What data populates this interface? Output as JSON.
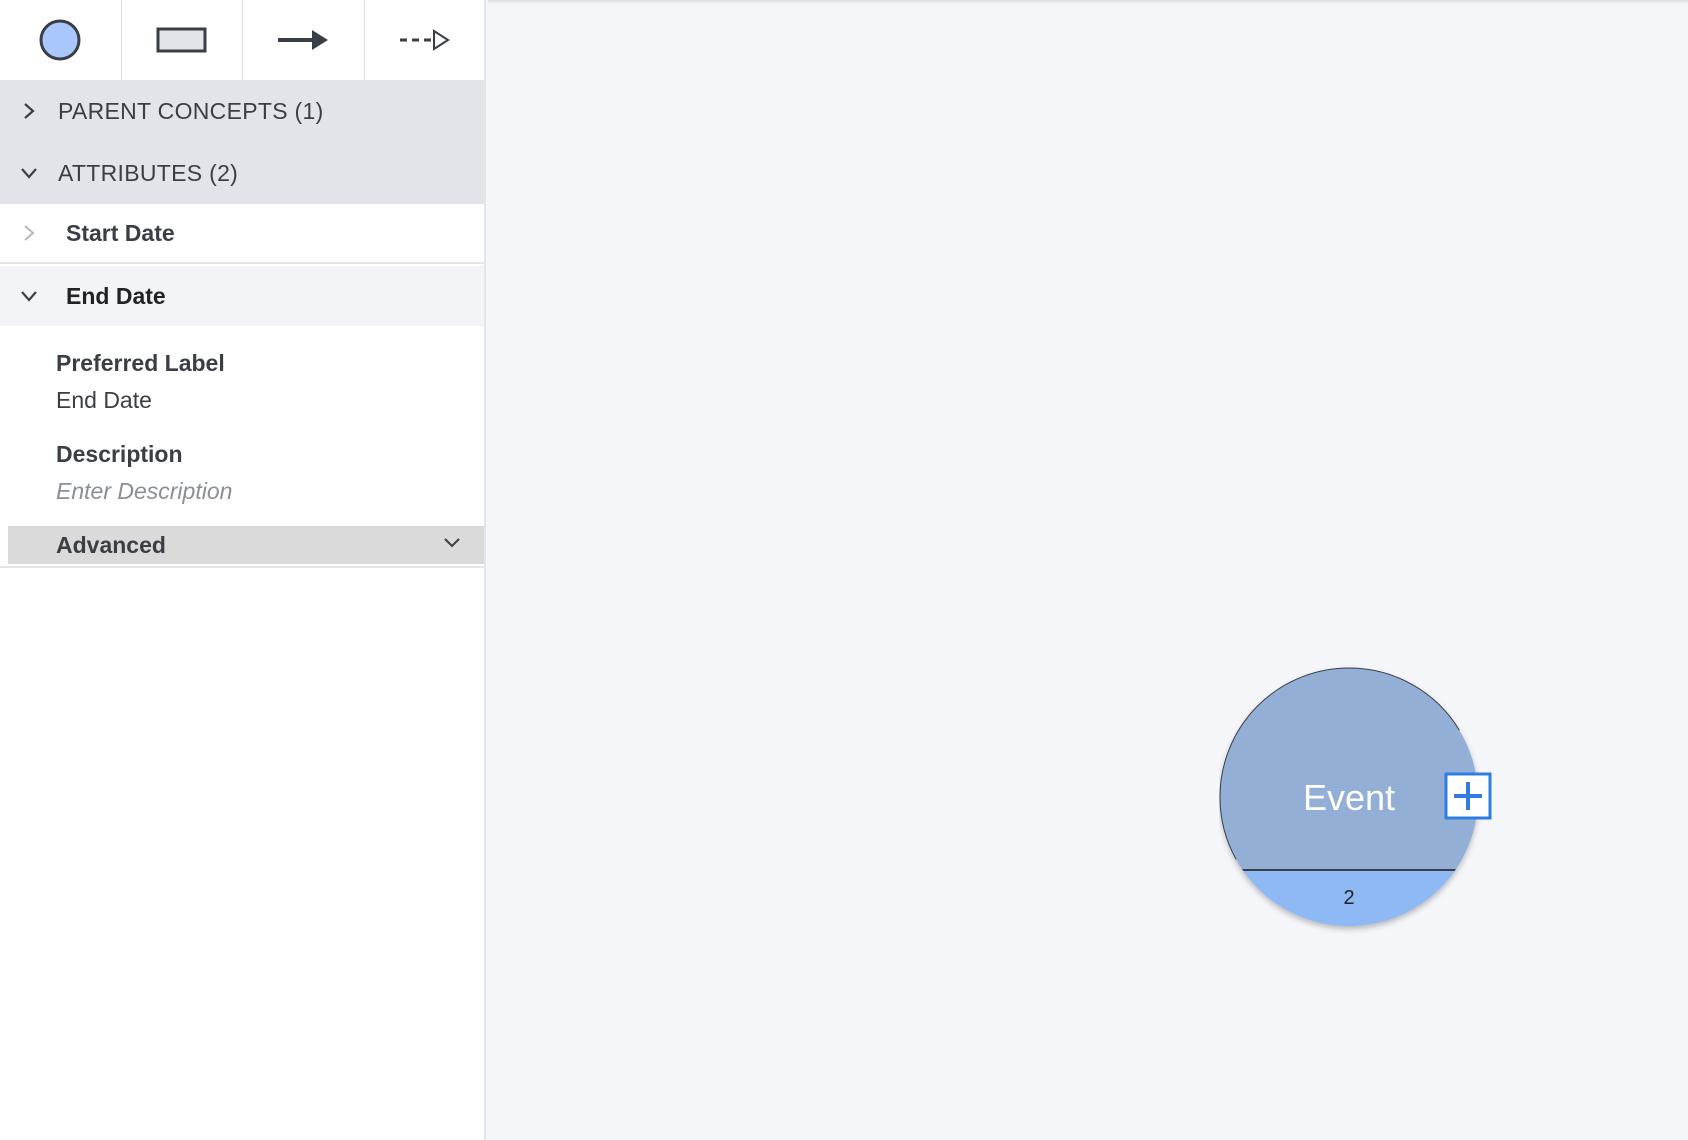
{
  "toolbar": {
    "tools": [
      {
        "icon": "circle-node-icon"
      },
      {
        "icon": "rectangle-node-icon"
      },
      {
        "icon": "solid-arrow-icon"
      },
      {
        "icon": "dashed-arrow-icon"
      }
    ]
  },
  "sidebar": {
    "parent_concepts_label": "PARENT CONCEPTS (1)",
    "attributes_label": "ATTRIBUTES (2)",
    "attributes": [
      {
        "label": "Start Date",
        "expanded": false
      },
      {
        "label": "End Date",
        "expanded": true
      }
    ],
    "detail": {
      "preferred_label_title": "Preferred Label",
      "preferred_label_value": "End Date",
      "description_title": "Description",
      "description_placeholder": "Enter Description",
      "advanced_label": "Advanced"
    }
  },
  "canvas": {
    "node": {
      "label": "Event",
      "count": "2",
      "fill_color": "#93afd6",
      "count_fill_color": "#8fb9f5",
      "add_button_color": "#2f7de1"
    }
  }
}
